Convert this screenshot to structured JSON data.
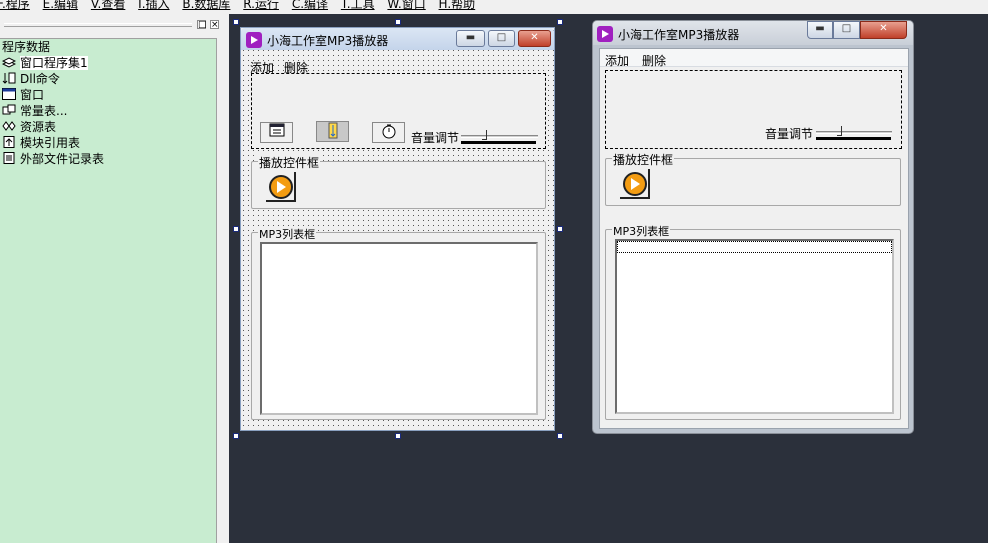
{
  "menubar": {
    "items": [
      "F.程序",
      "E.编辑",
      "V.查看",
      "I.插入",
      "B.数据库",
      "R.运行",
      "C.编译",
      "T.工具",
      "W.窗口",
      "H.帮助"
    ]
  },
  "panel": {
    "restore_btn": "□",
    "close_btn": "×"
  },
  "tree": {
    "root": "程序数据",
    "items": [
      {
        "label": "窗口程序集1",
        "icon": "window-set-icon"
      },
      {
        "label": "Dll命令",
        "icon": "dll-icon"
      },
      {
        "label": "窗口",
        "icon": "window-icon"
      },
      {
        "label": "常量表...",
        "icon": "constant-icon"
      },
      {
        "label": "资源表",
        "icon": "resource-icon"
      },
      {
        "label": "模块引用表",
        "icon": "module-icon"
      },
      {
        "label": "外部文件记录表",
        "icon": "file-record-icon"
      }
    ]
  },
  "design_window": {
    "title": "小海工作室MP3播放器",
    "menu": [
      "添加",
      "删除"
    ],
    "volume_label": "音量调节",
    "volume_level": 0.3,
    "play_group": "播放控件框",
    "list_group": "MP3列表框",
    "tool_icons": [
      "calendar-icon",
      "file-icon",
      "stopwatch-icon"
    ]
  },
  "preview_window": {
    "title": "小海工作室MP3播放器",
    "menu": [
      "添加",
      "删除"
    ],
    "volume_label": "音量调节",
    "volume_level": 0.3,
    "play_group": "播放控件框",
    "list_group": "MP3列表框"
  },
  "colors": {
    "tree_bg": "#c8ecd0",
    "workspace_bg": "#2b303b",
    "app_icon": "#a020c0",
    "play_accent": "#f39c12",
    "close_button": "#c0402a"
  }
}
